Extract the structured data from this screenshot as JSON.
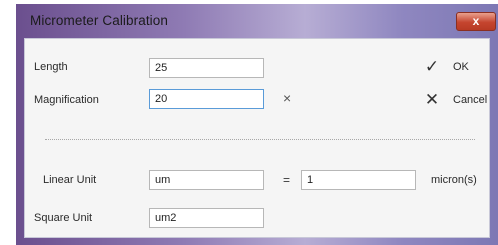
{
  "window": {
    "title": "Micrometer Calibration",
    "close_glyph": "x"
  },
  "form": {
    "length_label": "Length",
    "length_value": "25",
    "magnification_label": "Magnification",
    "magnification_value": "20",
    "multiply_glyph": "×",
    "linear_unit_label": "Linear Unit",
    "linear_unit_value": "um",
    "equals_sign": "=",
    "factor_value": "1",
    "micron_label": "micron(s)",
    "square_unit_label": "Square Unit",
    "square_unit_value": "um2"
  },
  "buttons": {
    "ok_label": "OK",
    "ok_icon": "✓",
    "cancel_label": "Cancel",
    "cancel_icon": "✕"
  },
  "colors": {
    "titlebar_accent": "#7d68a6",
    "close_button": "#c5452f",
    "client_bg": "#f5f5f5",
    "focus_border": "#5a9bd8"
  }
}
